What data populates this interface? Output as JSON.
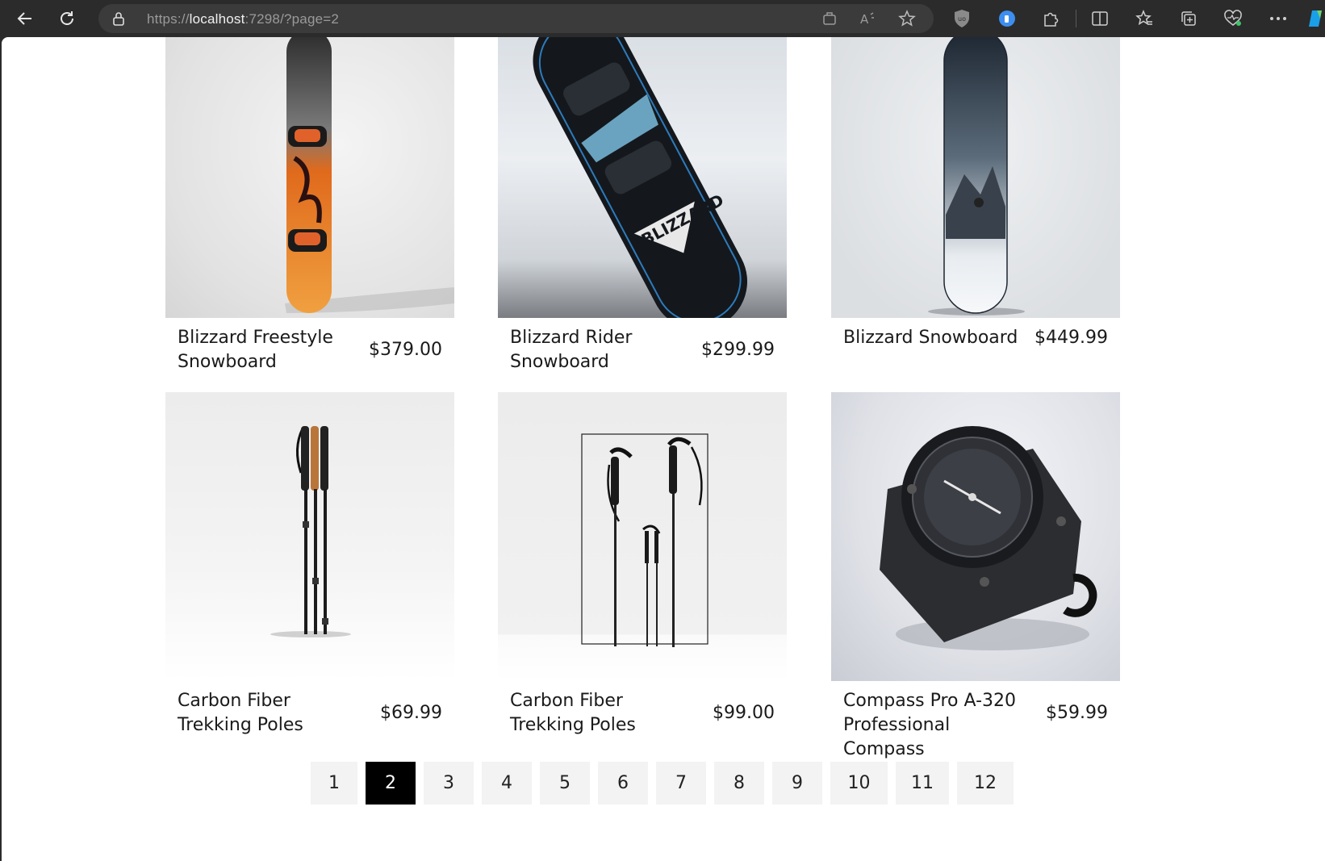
{
  "browser": {
    "url_prefix": "https://",
    "url_host": "localhost",
    "url_rest": ":7298/?page=2"
  },
  "products": [
    {
      "name": "Blizzard Freestyle Snowboard",
      "price": "$379.00"
    },
    {
      "name": "Blizzard Rider Snowboard",
      "price": "$299.99"
    },
    {
      "name": "Blizzard Snowboard",
      "price": "$449.99"
    },
    {
      "name": "Carbon Fiber Trekking Poles",
      "price": "$69.99"
    },
    {
      "name": "Carbon Fiber Trekking Poles",
      "price": "$99.00"
    },
    {
      "name": "Compass Pro A-320 Professional Compass",
      "price": "$59.99"
    }
  ],
  "pagination": {
    "pages": [
      "1",
      "2",
      "3",
      "4",
      "5",
      "6",
      "7",
      "8",
      "9",
      "10",
      "11",
      "12"
    ],
    "current": "2"
  }
}
